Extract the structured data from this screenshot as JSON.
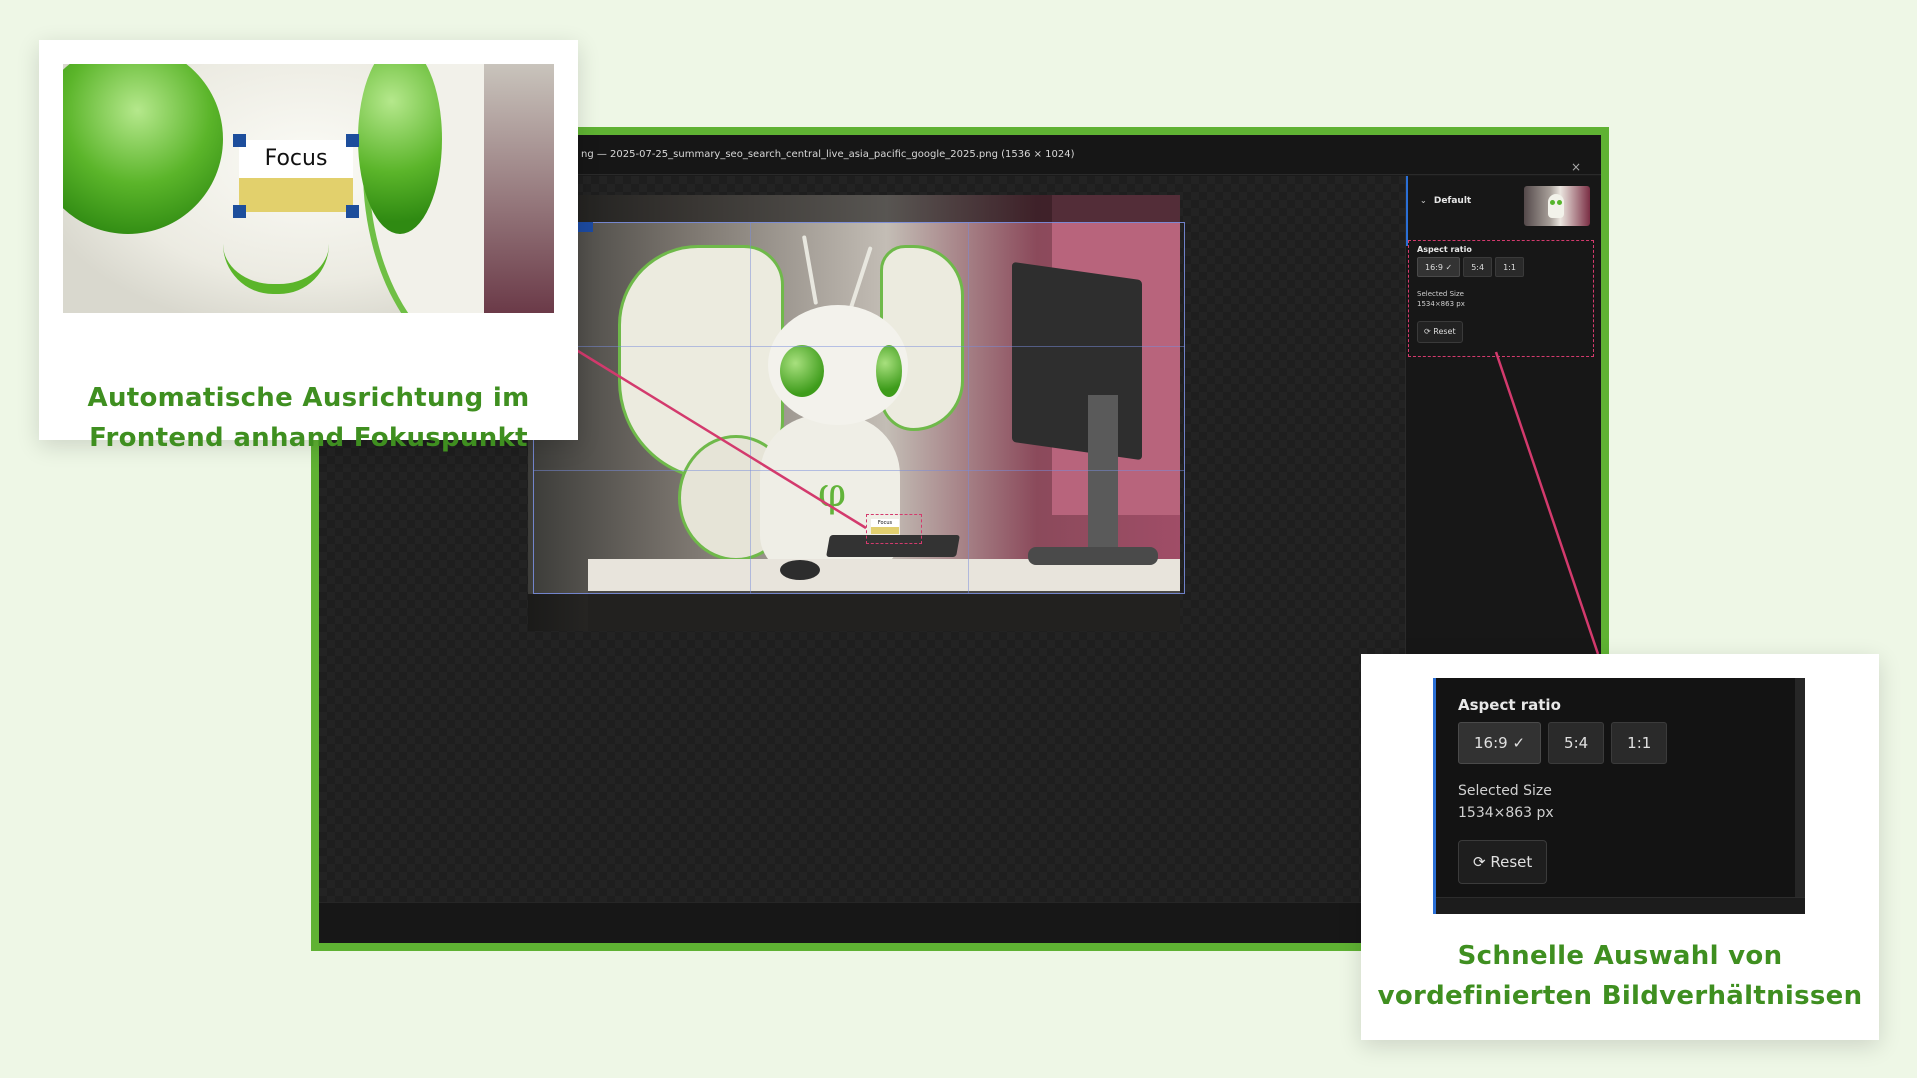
{
  "editor": {
    "title": "ng — 2025-07-25_summary_seo_search_central_live_asia_pacific_google_2025.png (1536 × 1024)",
    "close_icon": "×",
    "sidebar": {
      "variant_label": "Default",
      "aspect_ratio_label": "Aspect ratio",
      "ratios": [
        "16:9 ✓",
        "5:4",
        "1:1"
      ],
      "selected_ratio": "16:9",
      "selected_size_label": "Selected Size",
      "selected_size_value": "1534×863 px",
      "reset_label": "Reset"
    },
    "focus_area_label": "Focus",
    "crop_tag": "..ng"
  },
  "callout_focus": {
    "focus_label": "Focus",
    "title_line1": "Automatische Ausrichtung im",
    "title_line2": "Frontend anhand Fokuspunkt"
  },
  "callout_aspect": {
    "aspect_ratio_label": "Aspect ratio",
    "ratios": [
      "16:9 ✓",
      "5:4",
      "1:1"
    ],
    "selected_size_label": "Selected Size",
    "selected_size_value": "1534×863 px",
    "reset_label": "Reset",
    "title_line1": "Schnelle Auswahl von",
    "title_line2": "vordefinierten Bildverhältnissen"
  },
  "colors": {
    "background": "#eef7e6",
    "brand_green": "#5fb233",
    "headline_green": "#3f8f20",
    "annotation_pink": "#d33a6d",
    "focus_yellow": "#e2d06c",
    "handle_blue": "#1d4e9c"
  },
  "icons": {
    "chevron": "chevron-down-icon",
    "check": "check-icon",
    "reset": "refresh-icon",
    "close": "close-icon"
  }
}
